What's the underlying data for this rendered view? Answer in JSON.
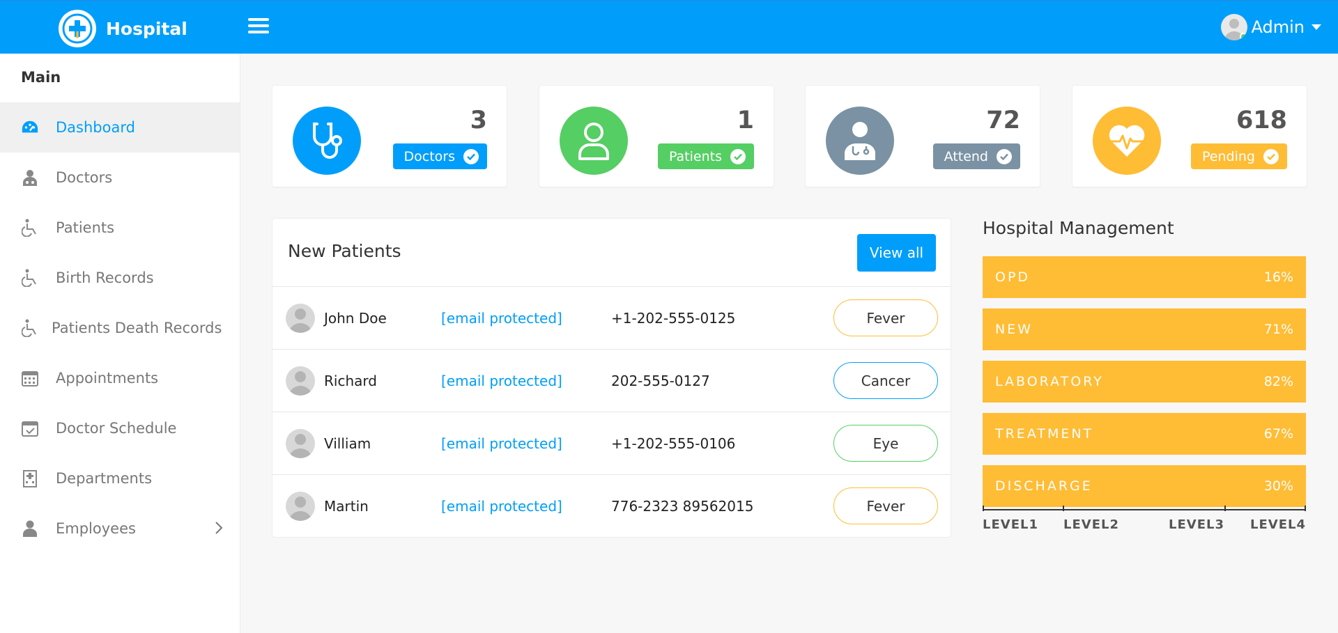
{
  "header": {
    "brand": "Hospital",
    "user_name": "Admin"
  },
  "sidebar": {
    "section_title": "Main",
    "items": [
      {
        "label": "Dashboard",
        "icon": "dashboard-icon",
        "active": true
      },
      {
        "label": "Doctors",
        "icon": "doctor-icon"
      },
      {
        "label": "Patients",
        "icon": "wheelchair-icon"
      },
      {
        "label": "Birth Records",
        "icon": "wheelchair-icon"
      },
      {
        "label": "Patients Death Records",
        "icon": "wheelchair-icon"
      },
      {
        "label": "Appointments",
        "icon": "calendar-icon"
      },
      {
        "label": "Doctor Schedule",
        "icon": "calendar-check-icon"
      },
      {
        "label": "Departments",
        "icon": "hospital-icon"
      },
      {
        "label": "Employees",
        "icon": "user-icon",
        "has_submenu": true
      }
    ]
  },
  "stats": [
    {
      "value": "3",
      "label": "Doctors",
      "color": "#009efb",
      "icon": "stethoscope-icon"
    },
    {
      "value": "1",
      "label": "Patients",
      "color": "#55ce63",
      "icon": "user-outline-icon"
    },
    {
      "value": "72",
      "label": "Attend",
      "color": "#7a92a3",
      "icon": "user-md-icon"
    },
    {
      "value": "618",
      "label": "Pending",
      "color": "#ffbc35",
      "icon": "heartbeat-icon"
    }
  ],
  "new_patients": {
    "title": "New Patients",
    "view_all_label": "View all",
    "rows": [
      {
        "name": "John Doe",
        "email": "[email protected]",
        "phone": "+1-202-555-0125",
        "condition": "Fever",
        "tag_color": "#ffbc35"
      },
      {
        "name": "Richard",
        "email": "[email protected]",
        "phone": "202-555-0127",
        "condition": "Cancer",
        "tag_color": "#009efb"
      },
      {
        "name": "Villiam",
        "email": "[email protected]",
        "phone": "+1-202-555-0106",
        "condition": "Eye",
        "tag_color": "#55ce63"
      },
      {
        "name": "Martin",
        "email": "[email protected]",
        "phone": "776-2323 89562015",
        "condition": "Fever",
        "tag_color": "#ffbc35"
      }
    ]
  },
  "hospital_management": {
    "title": "Hospital Management",
    "bar_color": "#ffbc35",
    "bars": [
      {
        "label": "OPD",
        "value": "16%"
      },
      {
        "label": "NEW",
        "value": "71%"
      },
      {
        "label": "LABORATORY",
        "value": "82%"
      },
      {
        "label": "TREATMENT",
        "value": "67%"
      },
      {
        "label": "DISCHARGE",
        "value": "30%"
      }
    ],
    "axis_labels": [
      "LEVEL1",
      "LEVEL2",
      "LEVEL3",
      "LEVEL4"
    ]
  }
}
